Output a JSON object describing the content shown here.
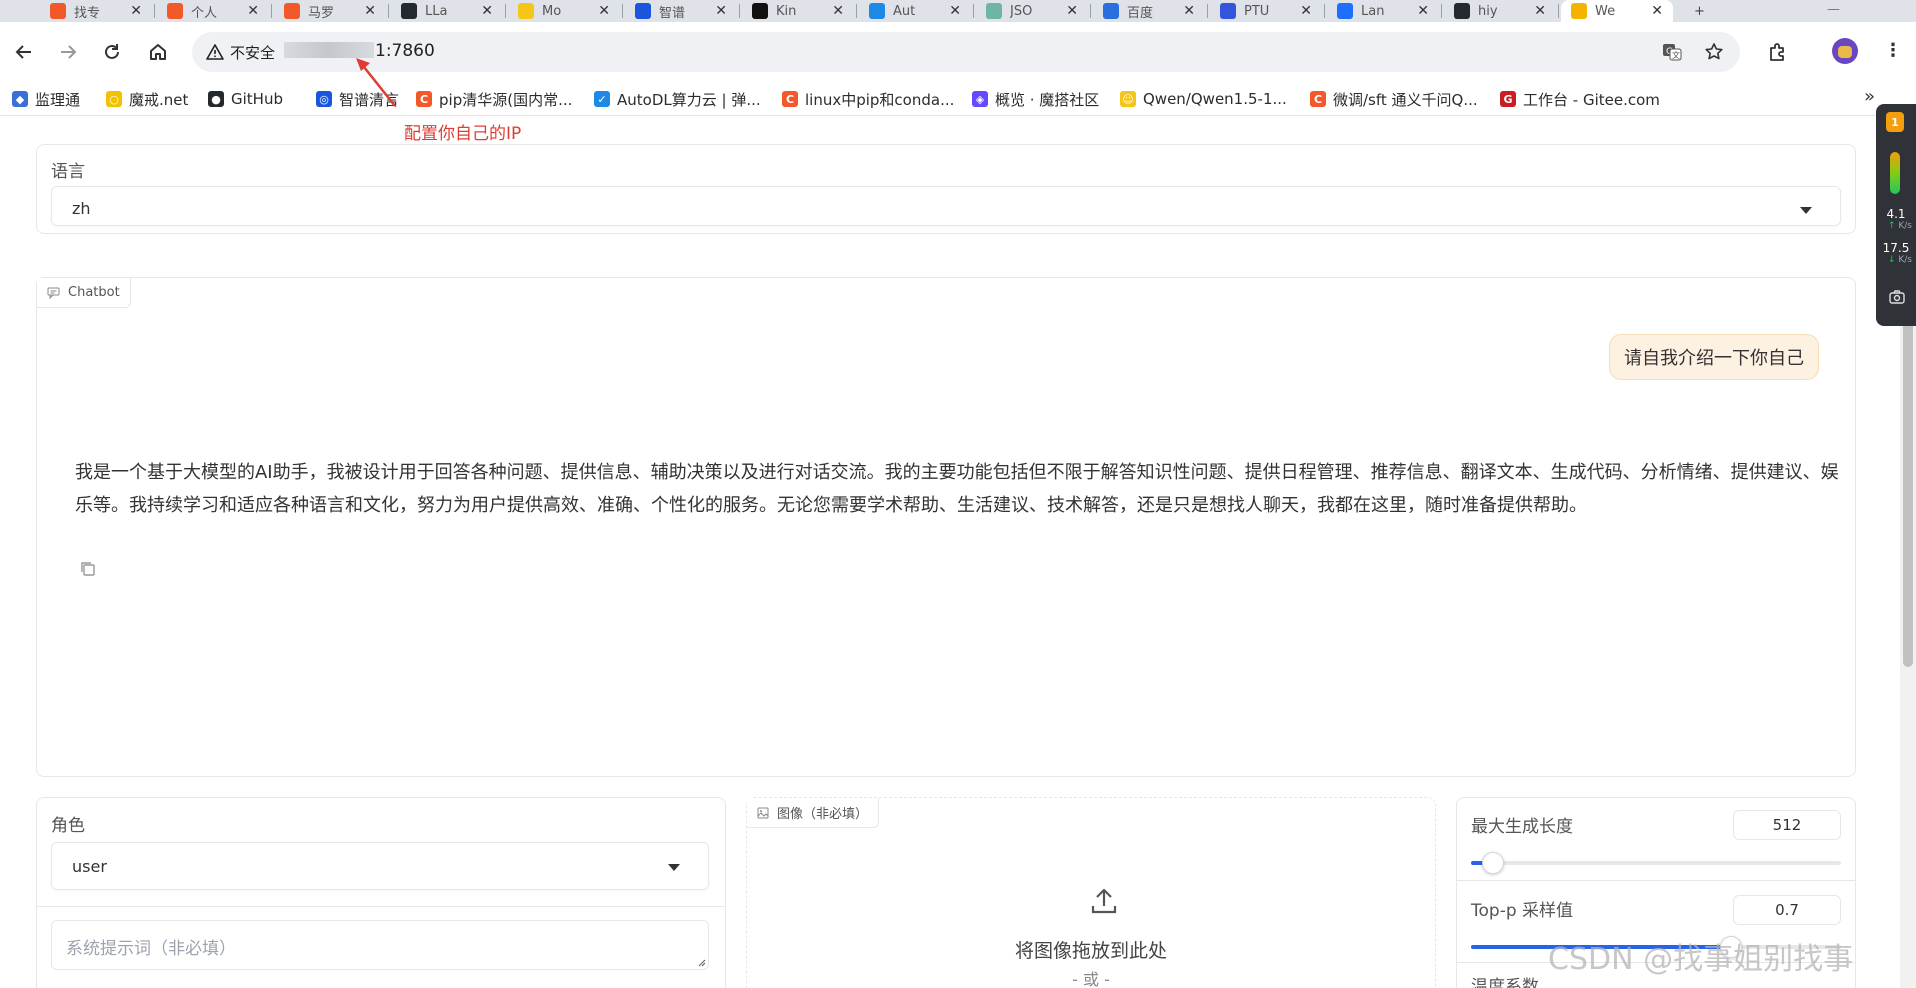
{
  "browser": {
    "tabs": [
      {
        "title": "找专",
        "color": "#f1592a"
      },
      {
        "title": "个人",
        "color": "#f1592a"
      },
      {
        "title": "马罗",
        "color": "#f1592a"
      },
      {
        "title": "LLa",
        "color": "#24292f"
      },
      {
        "title": "Mo",
        "color": "#f5c518"
      },
      {
        "title": "智谱",
        "color": "#1a56db"
      },
      {
        "title": "Kin",
        "color": "#111111"
      },
      {
        "title": "Aut",
        "color": "#1e88e5"
      },
      {
        "title": "JSO",
        "color": "#6fb5a4"
      },
      {
        "title": "百度",
        "color": "#2b6ede"
      },
      {
        "title": "PTU",
        "color": "#3455db"
      },
      {
        "title": "Lan",
        "color": "#1e6fff"
      },
      {
        "title": "hiy",
        "color": "#24292f"
      },
      {
        "title": "We",
        "color": "#f5b301"
      }
    ],
    "security_label": "不安全",
    "url_suffix": "1:7860",
    "bookmarks": [
      {
        "label": "监理通",
        "color": "#3b6fd8",
        "glyph": "◆"
      },
      {
        "label": "魔戒.net",
        "color": "#f2c200",
        "glyph": "○"
      },
      {
        "label": "GitHub",
        "color": "#24292f",
        "glyph": "●"
      },
      {
        "label": "智谱清言",
        "color": "#1a56db",
        "glyph": "◎"
      },
      {
        "label": "pip清华源(国内常...",
        "color": "#f1592a",
        "glyph": "C"
      },
      {
        "label": "AutoDL算力云 | 弹...",
        "color": "#1e88e5",
        "glyph": "✓"
      },
      {
        "label": "linux中pip和conda...",
        "color": "#f1592a",
        "glyph": "C"
      },
      {
        "label": "概览 · 魔搭社区",
        "color": "#624aff",
        "glyph": "◈"
      },
      {
        "label": "Qwen/Qwen1.5-1...",
        "color": "#f5c518",
        "glyph": "☺"
      },
      {
        "label": "微调/sft 通义千问Q...",
        "color": "#f1592a",
        "glyph": "C"
      },
      {
        "label": "工作台 - Gitee.com",
        "color": "#c71d23",
        "glyph": "G"
      }
    ]
  },
  "annotation": {
    "text": "配置你自己的IP"
  },
  "language": {
    "label": "语言",
    "value": "zh"
  },
  "chatbot": {
    "label": "Chatbot",
    "user_message": "请自我介绍一下你自己",
    "bot_message": "我是一个基于大模型的AI助手，我被设计用于回答各种问题、提供信息、辅助决策以及进行对话交流。我的主要功能包括但不限于解答知识性问题、提供日程管理、推荐信息、翻译文本、生成代码、分析情绪、提供建议、娱乐等。我持续学习和适应各种语言和文化，努力为用户提供高效、准确、个性化的服务。无论您需要学术帮助、生活建议、技术解答，还是只是想找人聊天，我都在这里，随时准备提供帮助。"
  },
  "role": {
    "label": "角色",
    "value": "user"
  },
  "system_prompt": {
    "placeholder": "系统提示词（非必填）"
  },
  "image_upload": {
    "label": "图像（非必填）",
    "drop_text": "将图像拖放到此处",
    "or_text": "- 或 -"
  },
  "params": {
    "max_length": {
      "label": "最大生成长度",
      "value": "512",
      "fraction": 0.06
    },
    "top_p": {
      "label": "Top-p 采样值",
      "value": "0.7",
      "fraction": 0.7
    },
    "temperature": {
      "label": "温度系数"
    }
  },
  "side_widget": {
    "level": "1",
    "up_speed": "4.1",
    "up_unit": "K/s",
    "down_speed": "17.5",
    "down_unit": "K/s"
  },
  "watermark": "CSDN @找事姐别找事"
}
